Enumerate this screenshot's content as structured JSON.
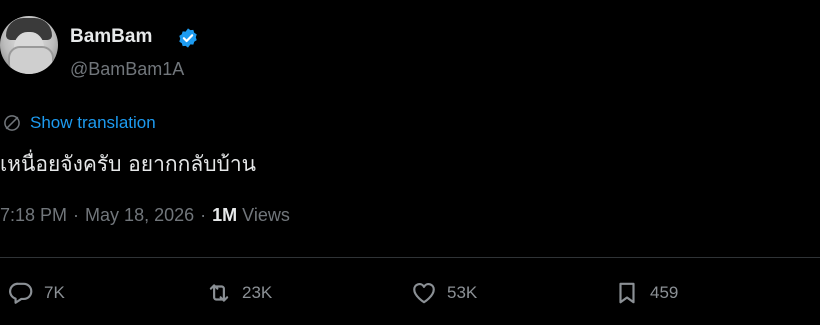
{
  "author": {
    "display_name": "BamBam",
    "handle": "@BamBam1A",
    "verified": true
  },
  "translation": {
    "label": "Show translation"
  },
  "tweet": {
    "text": "เหนื่อยจังครับ อยากกลับบ้าน"
  },
  "meta": {
    "time": "7:18 PM",
    "date": "May 18, 2026",
    "views_count": "1M",
    "views_label": "Views"
  },
  "actions": {
    "replies": "7K",
    "reposts": "23K",
    "likes": "53K",
    "bookmarks": "459"
  },
  "colors": {
    "background": "#000000",
    "text_primary": "#e7e9ea",
    "text_secondary": "#71767b",
    "accent": "#1d9bf0",
    "divider": "#2f3336"
  },
  "icons": {
    "verified": "verified-badge-icon",
    "translate": "globe-icon",
    "reply": "reply-icon",
    "repost": "repost-icon",
    "like": "heart-icon",
    "bookmark": "bookmark-icon"
  }
}
